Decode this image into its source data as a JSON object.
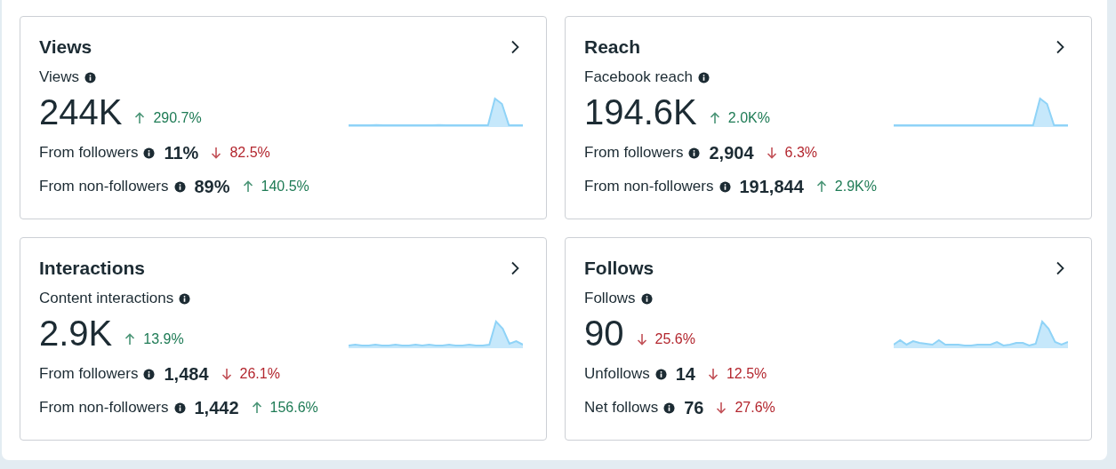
{
  "cards": [
    {
      "title": "Views",
      "metric": "Views",
      "value": "244K",
      "delta": {
        "text": "290.7%",
        "increase": true
      },
      "rows": [
        {
          "label": "From followers",
          "value": "11%",
          "delta": {
            "text": "82.5%",
            "increase": false
          }
        },
        {
          "label": "From non-followers",
          "value": "89%",
          "delta": {
            "text": "140.5%",
            "increase": true
          }
        }
      ]
    },
    {
      "title": "Reach",
      "metric": "Facebook reach",
      "value": "194.6K",
      "delta": {
        "text": "2.0K%",
        "increase": true
      },
      "rows": [
        {
          "label": "From followers",
          "value": "2,904",
          "delta": {
            "text": "6.3%",
            "increase": false
          }
        },
        {
          "label": "From non-followers",
          "value": "191,844",
          "delta": {
            "text": "2.9K%",
            "increase": true
          }
        }
      ]
    },
    {
      "title": "Interactions",
      "metric": "Content interactions",
      "value": "2.9K",
      "delta": {
        "text": "13.9%",
        "increase": true
      },
      "rows": [
        {
          "label": "From followers",
          "value": "1,484",
          "delta": {
            "text": "26.1%",
            "increase": false
          }
        },
        {
          "label": "From non-followers",
          "value": "1,442",
          "delta": {
            "text": "156.6%",
            "increase": true
          }
        }
      ]
    },
    {
      "title": "Follows",
      "metric": "Follows",
      "value": "90",
      "delta": {
        "text": "25.6%",
        "increase": false
      },
      "rows": [
        {
          "label": "Unfollows",
          "value": "14",
          "delta": {
            "text": "12.5%",
            "increase": false
          }
        },
        {
          "label": "Net follows",
          "value": "76",
          "delta": {
            "text": "27.6%",
            "increase": false
          }
        }
      ]
    }
  ]
}
